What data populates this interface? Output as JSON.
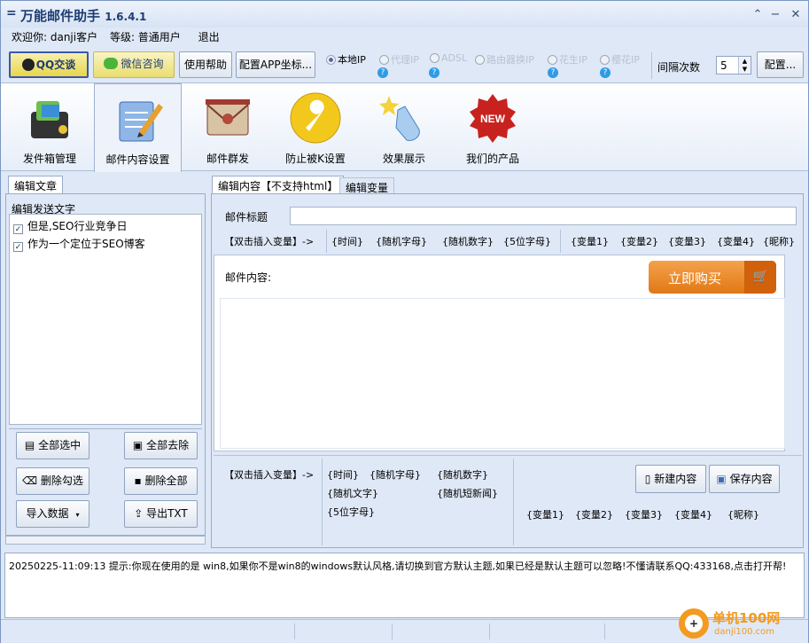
{
  "window": {
    "title": "万能邮件助手",
    "version": "1.6.4.1",
    "menu_glyph": "="
  },
  "welcome": {
    "greeting": "欢迎你: danji客户",
    "level": "等级: 普通用户",
    "logout": "退出"
  },
  "top_buttons": {
    "qq": "QQ交谈",
    "wechat": "微信咨询",
    "help": "使用帮助",
    "config_app": "配置APP坐标..."
  },
  "ip_modes": [
    {
      "label": "本地IP",
      "selected": true
    },
    {
      "label": "代理IP",
      "selected": false
    },
    {
      "label": "ADSL",
      "selected": false
    },
    {
      "label": "路由器换IP",
      "selected": false
    },
    {
      "label": "花生IP",
      "selected": false
    },
    {
      "label": "樱花IP",
      "selected": false
    }
  ],
  "interval": {
    "label": "间隔次数",
    "value": "5",
    "config": "配置..."
  },
  "toolbar": [
    {
      "label": "发件箱管理",
      "icon": "mailbox-icon"
    },
    {
      "label": "邮件内容设置",
      "icon": "notepad-icon"
    },
    {
      "label": "邮件群发",
      "icon": "envelope-icon"
    },
    {
      "label": "防止被K设置",
      "icon": "wrench-icon"
    },
    {
      "label": "效果展示",
      "icon": "hand-cursor-icon"
    },
    {
      "label": "我们的产品",
      "icon": "new-badge-icon"
    }
  ],
  "left": {
    "tab": "编辑文章",
    "group": "编辑发送文字",
    "items": [
      {
        "text": "但是,SEO行业竞争日",
        "checked": true
      },
      {
        "text": "作为一个定位于SEO博客",
        "checked": true
      }
    ],
    "buttons": {
      "select_all": "全部选中",
      "deselect_all": "全部去除",
      "delete_checked": "删除勾选",
      "delete_all": "删除全部",
      "import": "导入数据",
      "export": "导出TXT"
    }
  },
  "right": {
    "tabs": [
      "编辑内容【不支持html】",
      "编辑变量"
    ],
    "subject_label": "邮件标题",
    "subject_value": "",
    "insert_label": "【双击插入变量】->",
    "top_vars": [
      "{时间}",
      "{随机字母}",
      "{随机数字}",
      "{5位字母}",
      "{变量1}",
      "{变量2}",
      "{变量3}",
      "{变量4}",
      "{昵称}"
    ],
    "content_label": "邮件内容:",
    "buy": "立即购买",
    "bottom_vars_a": [
      "{时间}",
      "{随机字母}",
      "{随机数字}",
      "{随机文字}",
      "{随机短新闻}",
      "{5位字母}"
    ],
    "bottom_vars_b": [
      "{变量1}",
      "{变量2}",
      "{变量3}",
      "{变量4}",
      "{昵称}"
    ],
    "new_content": "新建内容",
    "save_content": "保存内容"
  },
  "log": "20250225-11:09:13  提示:你现在使用的是 win8,如果你不是win8的windows默认风格,请切换到官方默认主题,如果已经是默认主题可以忽略!不懂请联系QQ:433168,点击打开帮!",
  "watermark": {
    "text": "单机100网",
    "url": "danji100.com"
  }
}
